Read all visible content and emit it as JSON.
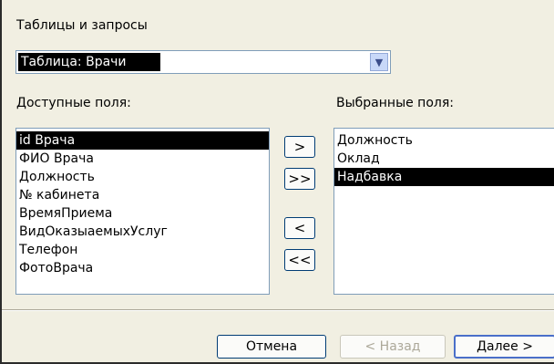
{
  "tables_label": "Таблицы и запросы",
  "combo": {
    "value": "Таблица: Врачи"
  },
  "available": {
    "label": "Доступные поля:",
    "items": [
      "id Врача",
      "ФИО Врача",
      "Должность",
      "№ кабинета",
      "ВремяПриема",
      "ВидОказыаемыхУслуг",
      "Телефон",
      "ФотоВрача"
    ],
    "selected_index": 0
  },
  "selected": {
    "label": "Выбранные поля:",
    "items": [
      "Должность",
      "Оклад",
      "Надбавка"
    ],
    "selected_index": 2
  },
  "move_buttons": {
    "add_one": ">",
    "add_all": ">>",
    "remove_one": "<",
    "remove_all": "<<"
  },
  "buttons": {
    "cancel": "Отмена",
    "back": "< Назад",
    "next": "Далее >"
  },
  "icons": {
    "dropdown": "chevron-down-icon"
  }
}
